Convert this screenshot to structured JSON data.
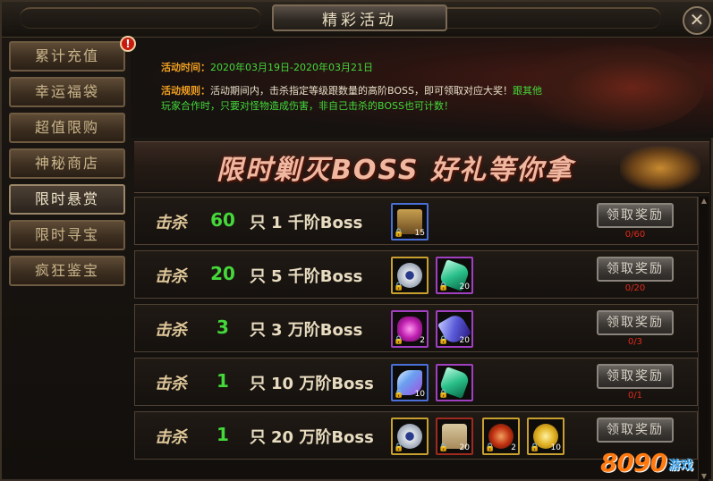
{
  "window": {
    "title": "精彩活动",
    "close_glyph": "✕"
  },
  "sidebar": {
    "alert_glyph": "!",
    "items": [
      {
        "label": "累计充值"
      },
      {
        "label": "幸运福袋"
      },
      {
        "label": "超值限购"
      },
      {
        "label": "神秘商店"
      },
      {
        "label": "限时悬赏",
        "active": true
      },
      {
        "label": "限时寻宝"
      },
      {
        "label": "疯狂鉴宝"
      }
    ]
  },
  "info": {
    "time_label": "活动时间：",
    "time_value": "2020年03月19日-2020年03月21日",
    "rule_label": "活动规则：",
    "rule_text_1": "活动期间内，击杀指定等级跟数量的高阶BOSS，即可领取对应大奖！",
    "rule_text_1b": "跟其他",
    "rule_text_2a": "玩家合作时，只要对怪物造成伤害，非自己击杀的BOSS也可计数！"
  },
  "banner": {
    "text": "限时剿灭BOSS   好礼等你拿"
  },
  "quests": [
    {
      "kill_label": "击杀",
      "count": "60",
      "unit": "只",
      "target": "1 千阶Boss",
      "button_label": "领取奖励",
      "progress": "0/60",
      "rewards": [
        {
          "icon": "treasure-chest-icon",
          "qty": "15",
          "border": "blue"
        }
      ]
    },
    {
      "kill_label": "击杀",
      "count": "20",
      "unit": "只",
      "target": "5 千阶Boss",
      "button_label": "领取奖励",
      "progress": "0/20",
      "rewards": [
        {
          "icon": "jade-disc-icon",
          "qty": "",
          "border": "gold"
        },
        {
          "icon": "green-crystal-icon",
          "qty": "20",
          "border": "purple"
        }
      ]
    },
    {
      "kill_label": "击杀",
      "count": "3",
      "unit": "只",
      "target": "3 万阶Boss",
      "button_label": "领取奖励",
      "progress": "0/3",
      "rewards": [
        {
          "icon": "purple-gem-icon",
          "qty": "2",
          "border": "purple"
        },
        {
          "icon": "blue-crystal-icon",
          "qty": "20",
          "border": "purple"
        }
      ]
    },
    {
      "kill_label": "击杀",
      "count": "1",
      "unit": "只",
      "target": "10 万阶Boss",
      "button_label": "领取奖励",
      "progress": "0/1",
      "rewards": [
        {
          "icon": "blue-feather-icon",
          "qty": "10",
          "border": "blue"
        },
        {
          "icon": "green-crystal-icon",
          "qty": "",
          "border": "purple"
        }
      ]
    },
    {
      "kill_label": "击杀",
      "count": "1",
      "unit": "只",
      "target": "20 万阶Boss",
      "button_label": "领取奖励",
      "progress": "",
      "rewards": [
        {
          "icon": "jade-disc-icon",
          "qty": "",
          "border": "gold"
        },
        {
          "icon": "scroll-icon",
          "qty": "20",
          "border": "red"
        },
        {
          "icon": "red-orb-icon",
          "qty": "2",
          "border": "gold"
        },
        {
          "icon": "legend-coin-icon",
          "qty": "10",
          "border": "gold"
        }
      ]
    }
  ],
  "lock_glyph": "🔒",
  "watermark": {
    "number": "8090",
    "text": "游戏"
  },
  "colors": {
    "accent_green": "#44d83a",
    "label_orange": "#f0a020",
    "progress_red": "#e02a1c"
  }
}
